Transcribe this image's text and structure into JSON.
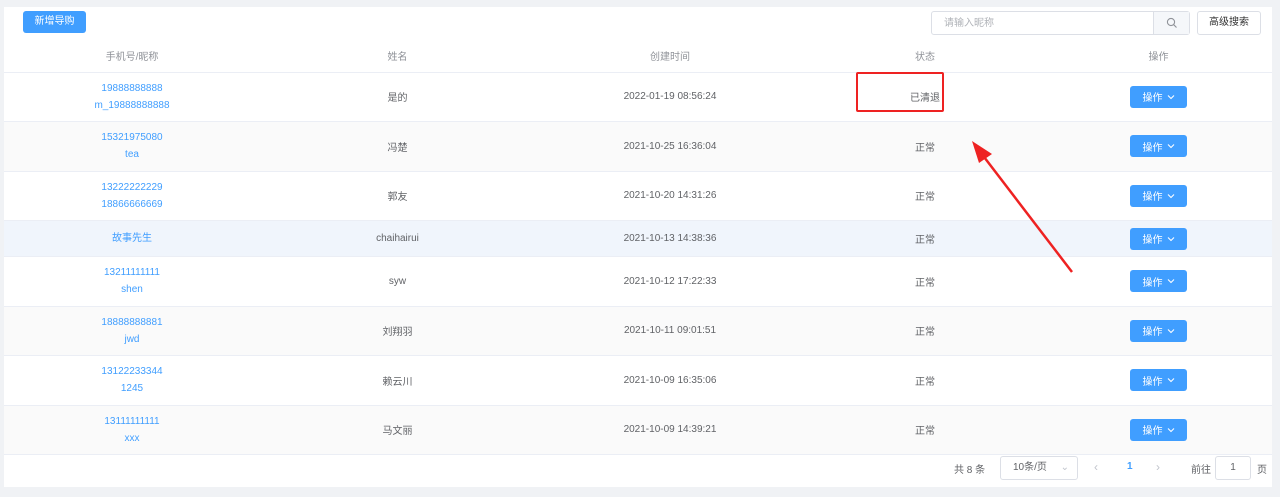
{
  "toolbar": {
    "add_button": "新增导购",
    "search_placeholder": "请输入昵称",
    "search_icon": "search-icon",
    "advanced_button": "高级搜索"
  },
  "table": {
    "headers": [
      "手机号/昵称",
      "姓名",
      "创建时间",
      "状态",
      "操作"
    ],
    "rows": [
      {
        "phone": "19888888888",
        "nickname": "m_19888888888",
        "name": "是的",
        "created": "2022-01-19 08:56:24",
        "status": "已清退",
        "action": "操作"
      },
      {
        "phone": "15321975080",
        "nickname": "tea",
        "name": "冯楚",
        "created": "2021-10-25 16:36:04",
        "status": "正常",
        "action": "操作"
      },
      {
        "phone": "13222222229",
        "nickname": "18866666669",
        "name": "郭友",
        "created": "2021-10-20 14:31:26",
        "status": "正常",
        "action": "操作"
      },
      {
        "phone": "故事先生",
        "nickname": "",
        "name": "chaihairui",
        "created": "2021-10-13 14:38:36",
        "status": "正常",
        "action": "操作"
      },
      {
        "phone": "13211111111",
        "nickname": "shen",
        "name": "syw",
        "created": "2021-10-12 17:22:33",
        "status": "正常",
        "action": "操作"
      },
      {
        "phone": "18888888881",
        "nickname": "jwd",
        "name": "刘翔羽",
        "created": "2021-10-11 09:01:51",
        "status": "正常",
        "action": "操作"
      },
      {
        "phone": "13122233344",
        "nickname": "1245",
        "name": "赖云川",
        "created": "2021-10-09 16:35:06",
        "status": "正常",
        "action": "操作"
      },
      {
        "phone": "13111111111",
        "nickname": "xxx",
        "name": "马文丽",
        "created": "2021-10-09 14:39:21",
        "status": "正常",
        "action": "操作"
      }
    ]
  },
  "pagination": {
    "total": "共 8 条",
    "page_size": "10条/页",
    "current_page": "1",
    "goto_prefix": "前往",
    "goto_value": "1",
    "goto_suffix": "页"
  },
  "colors": {
    "accent": "#409eff",
    "annotation": "#ee2222"
  }
}
